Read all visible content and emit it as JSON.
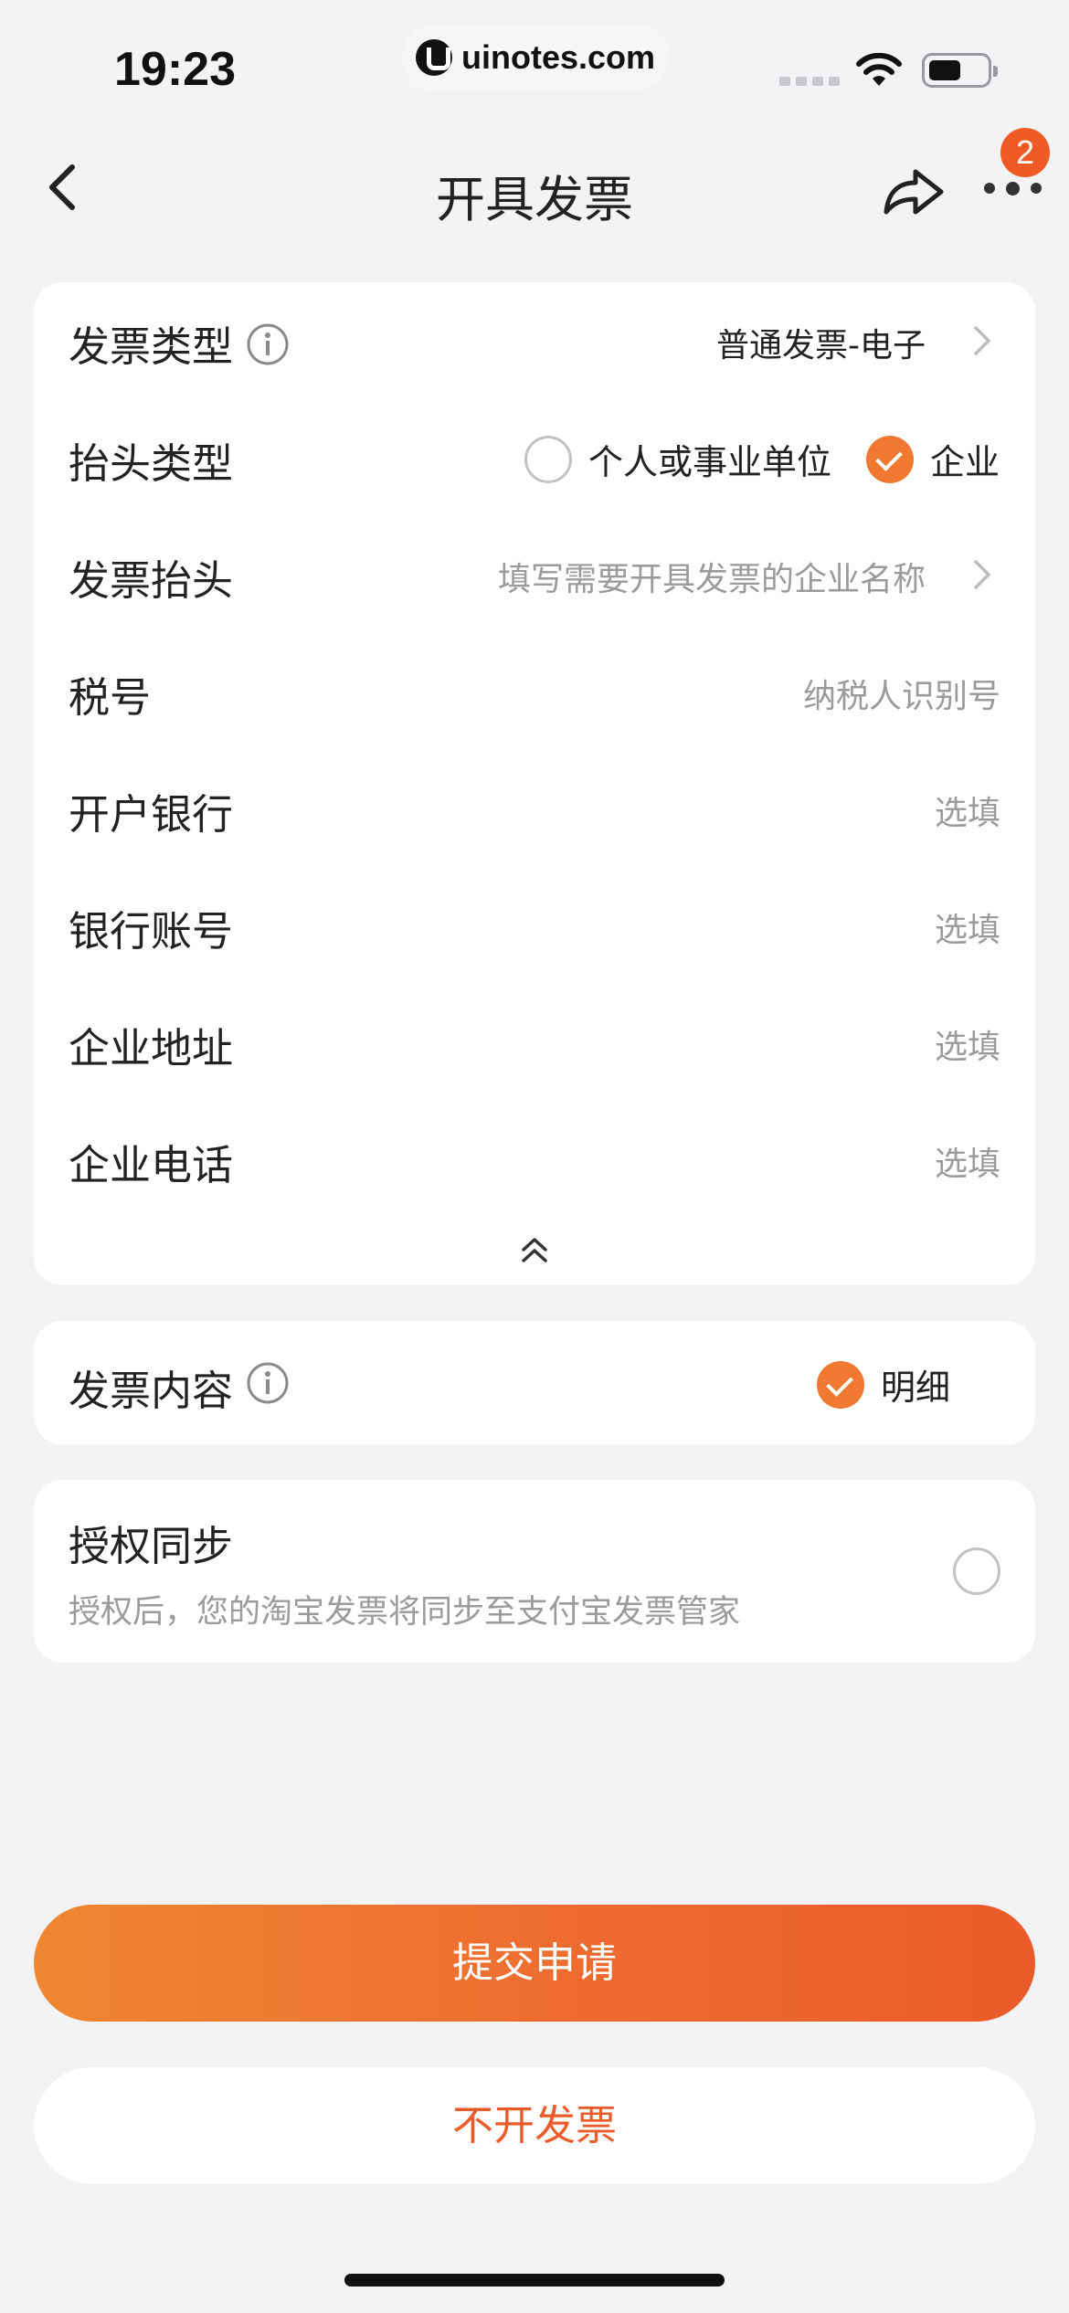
{
  "status_bar": {
    "time": "19:23",
    "url": "uinotes.com"
  },
  "nav": {
    "title": "开具发票",
    "badge_count": "2"
  },
  "invoice_form": {
    "invoice_type": {
      "label": "发票类型",
      "value": "普通发票-电子"
    },
    "title_type": {
      "label": "抬头类型",
      "options": [
        {
          "label": "个人或事业单位",
          "checked": false
        },
        {
          "label": "企业",
          "checked": true
        }
      ]
    },
    "invoice_title": {
      "label": "发票抬头",
      "placeholder": "填写需要开具发票的企业名称"
    },
    "tax_number": {
      "label": "税号",
      "placeholder": "纳税人识别号"
    },
    "bank": {
      "label": "开户银行",
      "placeholder": "选填"
    },
    "bank_account": {
      "label": "银行账号",
      "placeholder": "选填"
    },
    "company_address": {
      "label": "企业地址",
      "placeholder": "选填"
    },
    "company_phone": {
      "label": "企业电话",
      "placeholder": "选填"
    }
  },
  "invoice_content": {
    "label": "发票内容",
    "option": {
      "label": "明细",
      "checked": true
    }
  },
  "auth_sync": {
    "title": "授权同步",
    "description": "授权后，您的淘宝发票将同步至支付宝发票管家",
    "checked": false
  },
  "actions": {
    "submit_label": "提交申请",
    "cancel_label": "不开发票"
  },
  "colors": {
    "accent": "#f07830",
    "accent_dark": "#ea5b2a",
    "badge": "#ef5a25",
    "background": "#f3f3f5"
  },
  "icons": [
    "back-arrow-icon",
    "share-icon",
    "more-dots-icon",
    "info-icon",
    "chevron-right-icon",
    "collapse-up-icon",
    "checkmark-icon"
  ]
}
